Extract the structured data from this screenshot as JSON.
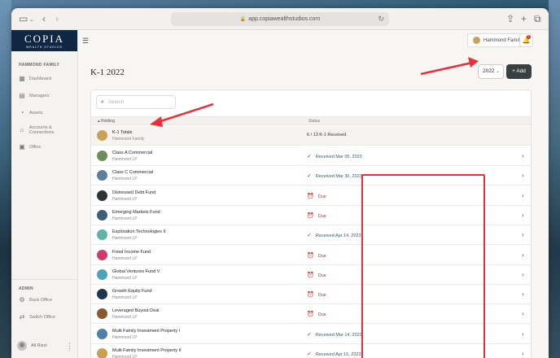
{
  "browser": {
    "url": "app.copiawealthstudios.com"
  },
  "sidebar": {
    "brand": "COPIA",
    "brand_sub": "WEALTH STUDIOS",
    "section_label": "HAMMOND FAMILY",
    "items": [
      {
        "label": "Dashboard",
        "icon": "dashboard-icon"
      },
      {
        "label": "Managers",
        "icon": "managers-icon"
      },
      {
        "label": "Assets",
        "icon": "assets-icon"
      },
      {
        "label": "Accounts & Connections",
        "icon": "bank-icon"
      },
      {
        "label": "Office",
        "icon": "briefcase-icon"
      }
    ],
    "admin_label": "ADMIN",
    "admin_items": [
      {
        "label": "Back Office",
        "icon": "gear-icon"
      },
      {
        "label": "Switch Office",
        "icon": "switch-icon"
      }
    ],
    "user": "Ali Rizvi"
  },
  "header": {
    "family_button": "Hammond Family",
    "notification_count": "1"
  },
  "page": {
    "title": "K-1 2022",
    "year": "2022",
    "add_label": "Add",
    "search_placeholder": "Search"
  },
  "table": {
    "col_holding": "Holding",
    "col_status": "Status",
    "totals": {
      "name": "K-1 Totals",
      "sub": "Hammond Family",
      "status": "6 / 13 K-1 Received"
    },
    "rows": [
      {
        "name": "Class A Commercial",
        "sub": "Hammond LP",
        "status": "Received Mar 05, 2023",
        "type": "received",
        "color": "#6b8f5a"
      },
      {
        "name": "Class C Commercial",
        "sub": "Hammond LP",
        "status": "Received Mar 30, 2023",
        "type": "received",
        "color": "#5a7fa3"
      },
      {
        "name": "Distressed Debt Fund",
        "sub": "Hammond LP",
        "status": "Due",
        "type": "due",
        "color": "#2f3436"
      },
      {
        "name": "Emerging Markets Fund",
        "sub": "Hammond LP",
        "status": "Due",
        "type": "due",
        "color": "#3d5f7a"
      },
      {
        "name": "Exploration Technologies II",
        "sub": "Hammond LP",
        "status": "Received Apr 14, 2023",
        "type": "received",
        "color": "#5fb3a8"
      },
      {
        "name": "Fixed Income Fund",
        "sub": "Hammond LP",
        "status": "Due",
        "type": "due",
        "color": "#d23a6e"
      },
      {
        "name": "Global Ventures Fund V",
        "sub": "Hammond LP",
        "status": "Due",
        "type": "due",
        "color": "#4aa3b8"
      },
      {
        "name": "Growth Equity Fund",
        "sub": "Hammond LP",
        "status": "Due",
        "type": "due",
        "color": "#1e3550"
      },
      {
        "name": "Leveraged Buyout Deal",
        "sub": "Hammond LP",
        "status": "Due",
        "type": "due",
        "color": "#8a5a2e"
      },
      {
        "name": "Multi Family Investment Property I",
        "sub": "Hammond LP",
        "status": "Received Mar 14, 2023",
        "type": "received",
        "color": "#4f7fa8"
      },
      {
        "name": "Multi Family Investment Property II",
        "sub": "Hammond LP",
        "status": "Received Apr 15, 2023",
        "type": "received",
        "color": "#c9a050"
      }
    ]
  },
  "annotation_color": "#e8303a"
}
